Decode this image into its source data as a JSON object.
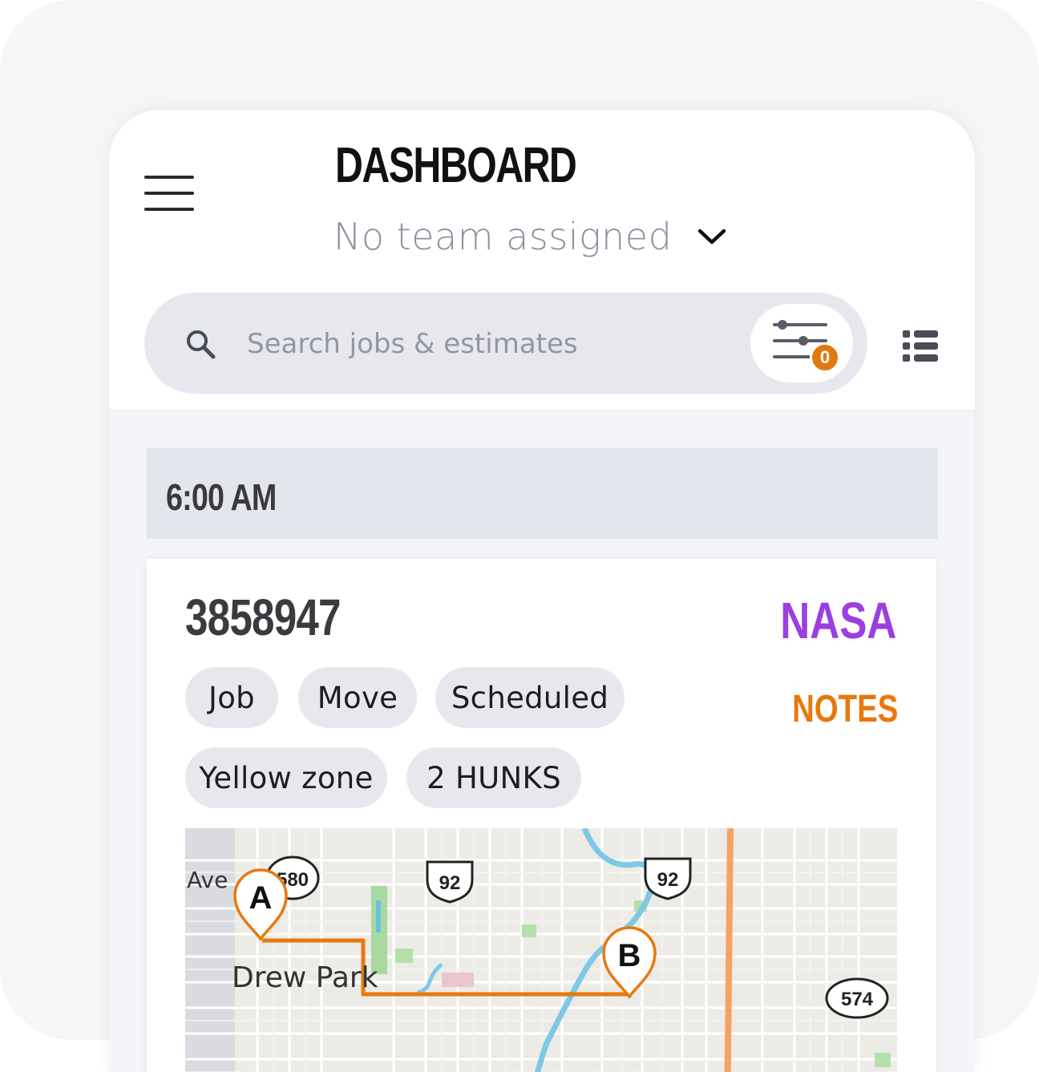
{
  "header": {
    "title": "DASHBOARD",
    "team_selector": "No team assigned"
  },
  "search": {
    "placeholder": "Search jobs & estimates",
    "filter_count": "0"
  },
  "schedule": {
    "time_slot": "6:00 AM",
    "job": {
      "number": "3858947",
      "client": "NASA",
      "notes_label": "NOTES",
      "tags": [
        "Job",
        "Move",
        "Scheduled",
        "Yellow zone",
        "2 HUNKS"
      ],
      "map": {
        "start_marker": "A",
        "end_marker": "B",
        "place_label": "Drew Park",
        "street_label": "Ave",
        "highway_shields": [
          "580",
          "92",
          "92",
          "574"
        ],
        "route_color": "#e8780e"
      }
    }
  },
  "colors": {
    "accent_orange": "#e8780e",
    "client_purple": "#9b3fe0",
    "chip_bg": "#e6e8ee"
  }
}
